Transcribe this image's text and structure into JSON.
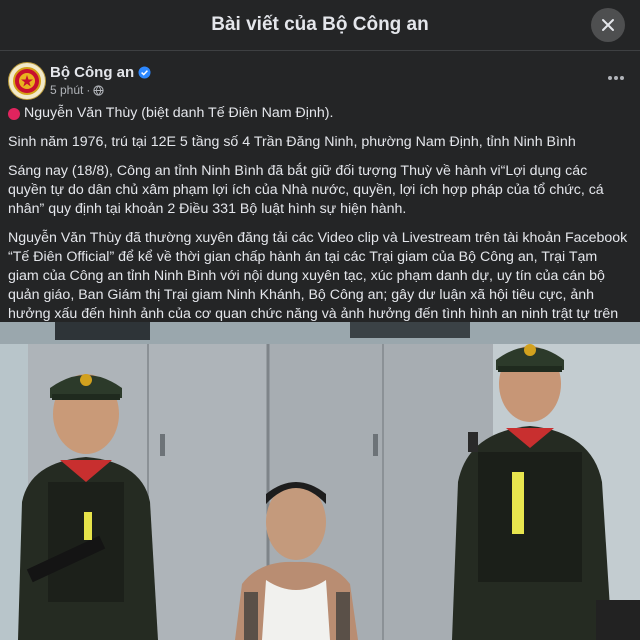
{
  "modal": {
    "title": "Bài viết của Bộ Công an",
    "close_icon": "close-icon"
  },
  "post": {
    "author": "Bộ Công an",
    "verified_icon": "verified-badge-icon",
    "time": "5 phút",
    "separator": "·",
    "audience_icon": "globe-icon",
    "more_icon": "more-horizontal-icon",
    "paragraphs": [
      "Nguyễn Văn Thùy (biệt danh Tế Điên Nam Định).",
      "Sinh năm 1976, trú tại 12E 5 tầng số 4 Trần Đăng Ninh, phường Nam Định, tỉnh Ninh Bình",
      "Sáng nay (18/8), Công an tỉnh Ninh Bình đã bắt giữ đối tượng Thuỳ về hành vi“Lợi dụng các quyền tự do dân chủ xâm phạm lợi ích của Nhà nước, quyền, lợi ích hợp pháp của tổ chức, cá nhân” quy định tại khoản 2 Điều 331 Bộ luật hình sự hiện hành.",
      "Nguyễn Văn Thùy đã thường xuyên đăng tải các Video clip và Livestream trên tài khoản Facebook “Tế Điên Official” để kể về thời gian chấp hành án tại các Trại giam của Bộ Công an, Trại Tạm giam của Công an tỉnh Ninh Bình với nội dung xuyên tạc, xúc phạm danh dự, uy tín của cán bộ quản giáo, Ban Giám thị Trại giam Ninh Khánh, Bộ Công an; gây dư luận xã hội tiêu cực, ảnh hưởng xấu đến hình ảnh của cơ quan chức năng và ảnh hưởng đến tình hình an ninh trật tự trên không gian mạng."
    ],
    "lead_icon": "red-circle-icon"
  },
  "colors": {
    "background": "#242526",
    "text": "#e4e6eb",
    "muted": "#b0b3b8",
    "verified": "#2d88ff"
  }
}
